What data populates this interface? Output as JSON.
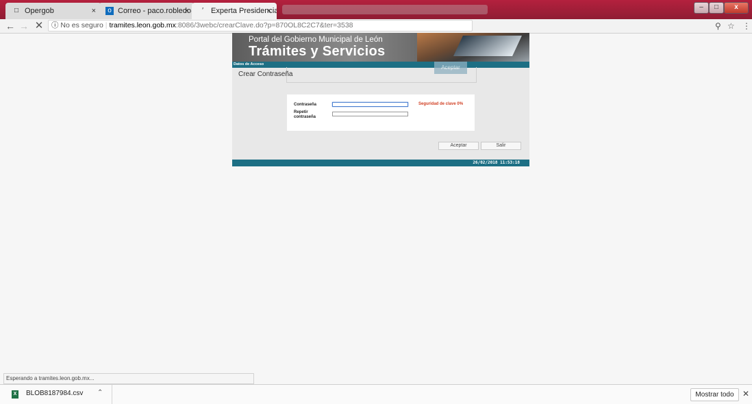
{
  "browser": {
    "tabs": [
      {
        "title": "Opergob",
        "icon": "page-icon"
      },
      {
        "title": "Correo - paco.robledo@",
        "icon": "outlook-icon"
      },
      {
        "title": "Experta Presidencia Mun",
        "icon": "loading-icon"
      }
    ],
    "tab_close": "×",
    "address": {
      "security": "No es seguro",
      "host": "tramites.leon.gob.mx",
      "path": ":8086/3webc/crearClave.do?p=870OL8C2C7&ter=3538"
    },
    "colors": {
      "titlebar": "#b4213e",
      "teal": "#1d6f84"
    }
  },
  "page": {
    "banner_sub": "Portal del Gobierno Municipal de León",
    "banner_main": "Trámites y Servicios",
    "section_label": "Datos de Acceso",
    "ghost_button": "Aceptar",
    "title": "Crear Contraseña",
    "form": {
      "password_label": "Contraseña",
      "repeat_label_1": "Repetir",
      "repeat_label_2": "contraseña",
      "password_value": "",
      "repeat_value": "",
      "strength": "Seguridad de clave 0%"
    },
    "accept_button": "Aceptar",
    "exit_button": "Salir",
    "datetime": "26/02/2018 11:53:18"
  },
  "status": "Esperando a tramites.leon.gob.mx...",
  "downloads": {
    "file": "BLOB8187984.csv",
    "show_all": "Mostrar todo"
  }
}
